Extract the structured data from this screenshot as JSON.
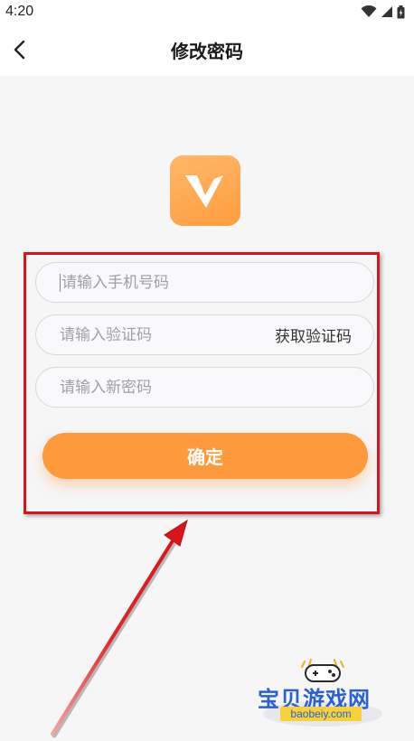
{
  "status_bar": {
    "time": "4:20"
  },
  "header": {
    "title": "修改密码"
  },
  "form": {
    "phone_placeholder": "请输入手机号码",
    "code_placeholder": "请输入验证码",
    "get_code_label": "获取验证码",
    "new_password_placeholder": "请输入新密码",
    "confirm_label": "确定"
  },
  "colors": {
    "accent": "#ff9a3c",
    "highlight": "#d9151b"
  },
  "watermark": {
    "title": "宝贝游戏网",
    "url": "baobeiy.com"
  },
  "icons": [
    "wifi-icon",
    "signal-icon",
    "battery-icon",
    "back-arrow-icon",
    "app-logo-icon",
    "gamepad-icon"
  ]
}
